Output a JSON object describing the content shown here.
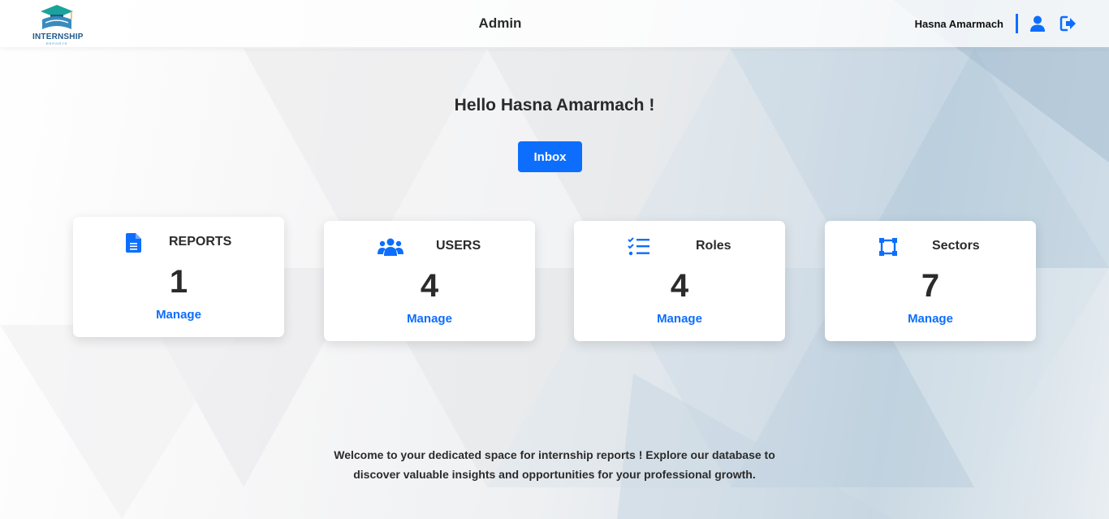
{
  "header": {
    "logo_text": "INTERNSHIP",
    "logo_sub": "REPORTS",
    "title": "Admin",
    "user_name": "Hasna Amarmach",
    "icons": {
      "profile": "user-icon",
      "logout": "logout-icon"
    }
  },
  "main": {
    "greeting": "Hello Hasna Amarmach !",
    "inbox_label": "Inbox",
    "cards": [
      {
        "label": "REPORTS",
        "count": "1",
        "link": "Manage",
        "icon": "file-icon"
      },
      {
        "label": "USERS",
        "count": "4",
        "link": "Manage",
        "icon": "users-icon"
      },
      {
        "label": "Roles",
        "count": "4",
        "link": "Manage",
        "icon": "list-check-icon"
      },
      {
        "label": "Sectors",
        "count": "7",
        "link": "Manage",
        "icon": "vector-square-icon"
      }
    ],
    "footer_line1": "Welcome to your dedicated space for internship reports ! Explore our database to",
    "footer_line2": "discover valuable insights and opportunities for your professional growth."
  },
  "colors": {
    "accent": "#0d6efd",
    "text": "#2b2b2b",
    "card_bg": "#ffffff"
  }
}
